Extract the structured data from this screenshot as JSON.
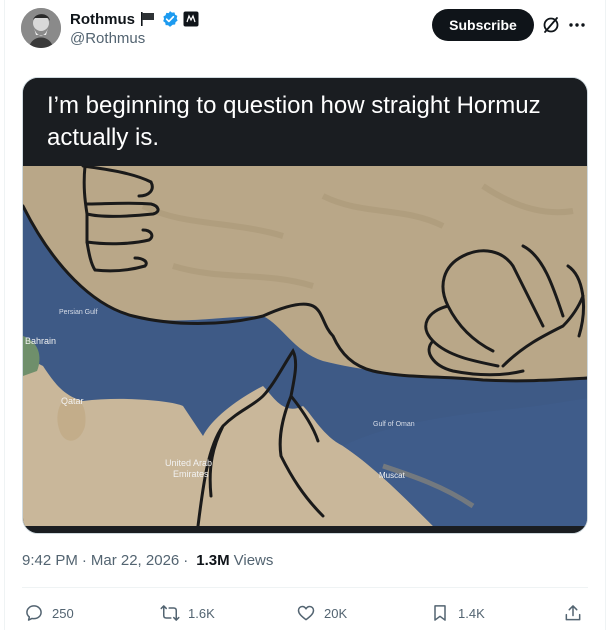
{
  "author": {
    "name": "Rothmus",
    "handle": "@Rothmus"
  },
  "header": {
    "subscribe_label": "Subscribe"
  },
  "post": {
    "text": "I’m beginning to question how straight Hormuz actually is.",
    "time": "9:42 PM",
    "date": "Mar 22, 2026",
    "views_count": "1.3M",
    "views_label": "Views"
  },
  "map_labels": {
    "bahrain": "Bahrain",
    "qatar": "Qatar",
    "uae_line1": "United Arab",
    "uae_line2": "Emirates",
    "muscat": "Muscat",
    "persian_gulf": "Persian Gulf",
    "gulf_of_oman": "Gulf of Oman"
  },
  "actions": {
    "replies": "250",
    "reposts": "1.6K",
    "likes": "20K",
    "bookmarks": "1.4K"
  },
  "colors": {
    "accent": "#1d9bf0",
    "text_primary": "#0f1419",
    "text_secondary": "#536471",
    "verified": "#1d9bf0"
  },
  "icons": {
    "flag": "flag-icon",
    "verified": "verified-badge-icon",
    "affiliate": "affiliate-badge-icon",
    "grok": "grok-icon",
    "more": "more-icon",
    "reply": "reply-icon",
    "repost": "repost-icon",
    "like": "like-icon",
    "bookmark": "bookmark-icon",
    "share": "share-icon"
  }
}
